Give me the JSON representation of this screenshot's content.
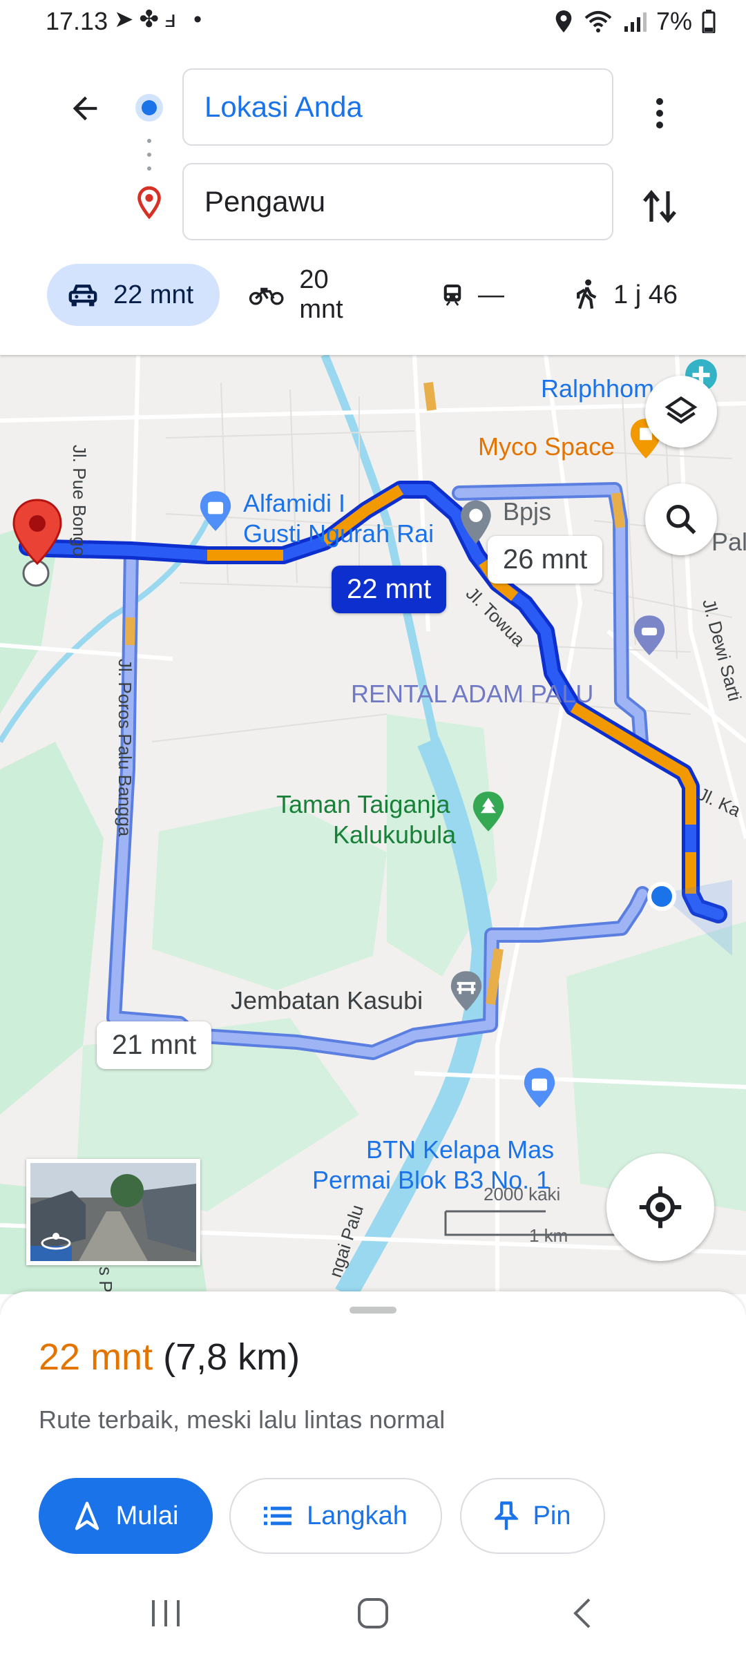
{
  "status_bar": {
    "time": "17.13",
    "battery": "7%"
  },
  "directions": {
    "origin": "Lokasi Anda",
    "destination": "Pengawu"
  },
  "modes": [
    {
      "name": "car",
      "label": "22 mnt",
      "active": true
    },
    {
      "name": "motorcycle",
      "label": "20 mnt"
    },
    {
      "name": "transit",
      "label": "—"
    },
    {
      "name": "walk",
      "label": "1 j 46"
    }
  ],
  "map": {
    "places": {
      "ralphhome": "Ralphhom",
      "myco": "Myco Space",
      "alfamidi_1": "Alfamidi I",
      "alfamidi_2": "Gusti Ngurah Rai",
      "bpjs": "Bpjs",
      "pal": "Pal",
      "rental": "RENTAL ADAM PALU",
      "taman_1": "Taman Taiganja",
      "taman_2": "Kalukubula",
      "jembatan": "Jembatan Kasubi",
      "btn_1": "BTN Kelapa Mas",
      "btn_2": "Permai Blok B3 No. 1"
    },
    "roads": {
      "pue_bongo": "Jl. Pue Bongo",
      "poros": "Jl. Poros Palu Bangga",
      "towua": "Jl. Towua",
      "dewi": "Jl. Dewi Sarti",
      "ka": "Jl. Ka",
      "sungai": "ngai Palu",
      "poros_bottom": "s Po"
    },
    "route_chips": {
      "main": "22 mnt",
      "alt1": "26 mnt",
      "alt2": "21 mnt"
    },
    "scale": {
      "imperial": "2000 kaki",
      "metric": "1 km"
    },
    "colors": {
      "route": "#1a3ef0",
      "alt_route": "#8ea6f0",
      "traffic": "#f29900",
      "park": "#cdeed8",
      "river": "#9ad8ef"
    }
  },
  "sheet": {
    "duration": "22 mnt",
    "distance": "(7,8 km)",
    "description": "Rute terbaik, meski lalu lintas normal",
    "buttons": {
      "start": "Mulai",
      "steps": "Langkah",
      "pin": "Pin"
    }
  }
}
